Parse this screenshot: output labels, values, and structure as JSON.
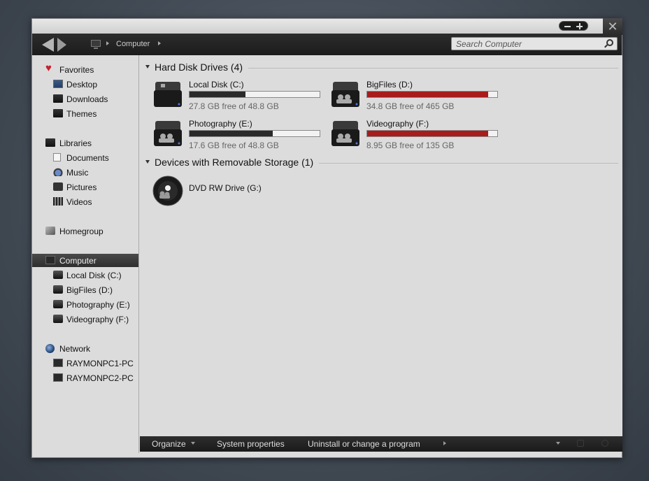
{
  "window": {
    "breadcrumb": "Computer",
    "search_placeholder": "Search Computer"
  },
  "sidebar": {
    "favorites": {
      "label": "Favorites",
      "items": [
        {
          "label": "Desktop",
          "icon": "desktop-icon"
        },
        {
          "label": "Downloads",
          "icon": "folder-icon"
        },
        {
          "label": "Themes",
          "icon": "folder-icon"
        }
      ]
    },
    "libraries": {
      "label": "Libraries",
      "items": [
        {
          "label": "Documents",
          "icon": "document-icon"
        },
        {
          "label": "Music",
          "icon": "music-icon"
        },
        {
          "label": "Pictures",
          "icon": "pictures-icon"
        },
        {
          "label": "Videos",
          "icon": "video-icon"
        }
      ]
    },
    "homegroup": {
      "label": "Homegroup"
    },
    "computer": {
      "label": "Computer",
      "items": [
        {
          "label": "Local Disk (C:)"
        },
        {
          "label": "BigFiles (D:)"
        },
        {
          "label": "Photography (E:)"
        },
        {
          "label": "Videography (F:)"
        }
      ]
    },
    "network": {
      "label": "Network",
      "items": [
        {
          "label": "RAYMONPC1-PC"
        },
        {
          "label": "RAYMONPC2-PC"
        }
      ]
    }
  },
  "content": {
    "hard_disks": {
      "header": "Hard Disk Drives (4)",
      "drives": [
        {
          "name": "Local Disk (C:)",
          "free": "27.8 GB free of 48.8 GB",
          "used_fraction": 0.43,
          "bar_color": "#2a2a2a"
        },
        {
          "name": "BigFiles (D:)",
          "free": "34.8 GB free of 465 GB",
          "used_fraction": 0.93,
          "bar_color": "#a81c1c"
        },
        {
          "name": "Photography (E:)",
          "free": "17.6 GB free of 48.8 GB",
          "used_fraction": 0.64,
          "bar_color": "#2a2a2a"
        },
        {
          "name": "Videography (F:)",
          "free": "8.95 GB free of 135 GB",
          "used_fraction": 0.93,
          "bar_color": "#a81c1c"
        }
      ]
    },
    "removable": {
      "header": "Devices with Removable Storage (1)",
      "devices": [
        {
          "name": "DVD RW Drive (G:)"
        }
      ]
    }
  },
  "commandbar": {
    "organize": "Organize",
    "system_properties": "System properties",
    "uninstall": "Uninstall or change a program"
  },
  "colors": {
    "accent_dark": "#1c1c1c",
    "warning_red": "#a81c1c",
    "background": "#dcdcdc"
  }
}
